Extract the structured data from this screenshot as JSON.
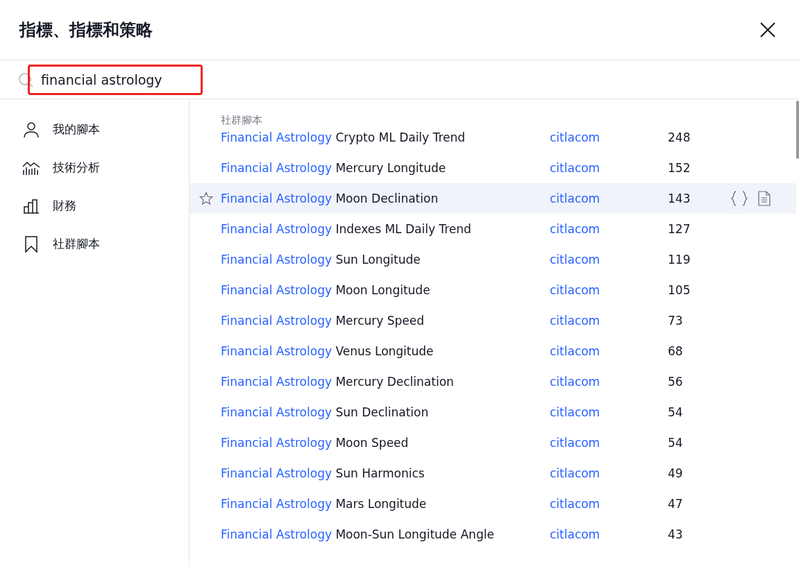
{
  "dialog": {
    "title": "指標、指標和策略"
  },
  "search": {
    "value": "financial astrology",
    "highlighted": true
  },
  "sidebar": {
    "items": [
      {
        "kind": "person",
        "label": "我的腳本"
      },
      {
        "kind": "chart",
        "label": "技術分析"
      },
      {
        "kind": "bars",
        "label": "財務"
      },
      {
        "kind": "bookmark",
        "label": "社群腳本"
      }
    ]
  },
  "results": {
    "section_label": "社群腳本",
    "rows": [
      {
        "match": "Financial Astrology",
        "rest": "Crypto ML Daily Trend",
        "author": "citlacom",
        "count": "248",
        "highlighted": false
      },
      {
        "match": "Financial Astrology",
        "rest": "Mercury Longitude",
        "author": "citlacom",
        "count": "152",
        "highlighted": false
      },
      {
        "match": "Financial Astrology",
        "rest": "Moon Declination",
        "author": "citlacom",
        "count": "143",
        "highlighted": true
      },
      {
        "match": "Financial Astrology",
        "rest": "Indexes ML Daily Trend",
        "author": "citlacom",
        "count": "127",
        "highlighted": false
      },
      {
        "match": "Financial Astrology",
        "rest": "Sun Longitude",
        "author": "citlacom",
        "count": "119",
        "highlighted": false
      },
      {
        "match": "Financial Astrology",
        "rest": "Moon Longitude",
        "author": "citlacom",
        "count": "105",
        "highlighted": false
      },
      {
        "match": "Financial Astrology",
        "rest": "Mercury Speed",
        "author": "citlacom",
        "count": "73",
        "highlighted": false
      },
      {
        "match": "Financial Astrology",
        "rest": "Venus Longitude",
        "author": "citlacom",
        "count": "68",
        "highlighted": false
      },
      {
        "match": "Financial Astrology",
        "rest": "Mercury Declination",
        "author": "citlacom",
        "count": "56",
        "highlighted": false
      },
      {
        "match": "Financial Astrology",
        "rest": "Sun Declination",
        "author": "citlacom",
        "count": "54",
        "highlighted": false
      },
      {
        "match": "Financial Astrology",
        "rest": "Moon Speed",
        "author": "citlacom",
        "count": "54",
        "highlighted": false
      },
      {
        "match": "Financial Astrology",
        "rest": "Sun Harmonics",
        "author": "citlacom",
        "count": "49",
        "highlighted": false
      },
      {
        "match": "Financial Astrology",
        "rest": "Mars Longitude",
        "author": "citlacom",
        "count": "47",
        "highlighted": false
      },
      {
        "match": "Financial Astrology",
        "rest": "Moon-Sun Longitude Angle",
        "author": "citlacom",
        "count": "43",
        "highlighted": false
      }
    ]
  }
}
